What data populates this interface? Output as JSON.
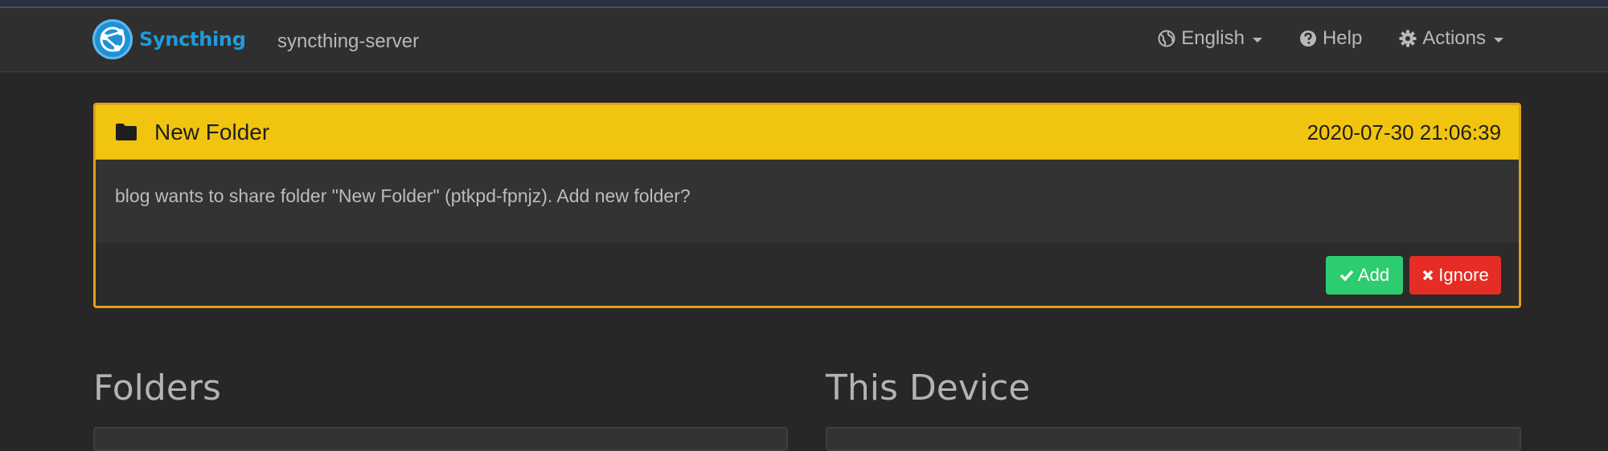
{
  "navbar": {
    "brand": "Syncthing",
    "device_name": "syncthing-server",
    "language_label": "English",
    "help_label": "Help",
    "actions_label": "Actions",
    "icons": {
      "logo": "syncthing-logo",
      "language": "globe-icon",
      "help": "question-circle-icon",
      "actions": "gear-icon"
    }
  },
  "notification": {
    "title": "New Folder",
    "timestamp": "2020-07-30 21:06:39",
    "message": "blog wants to share folder \"New Folder\" (ptkpd-fpnjz). Add new folder?",
    "add_label": "Add",
    "ignore_label": "Ignore",
    "colors": {
      "heading": "#f1c40f",
      "border": "#e1a01b",
      "add": "#2ecc71",
      "ignore": "#e52d25"
    }
  },
  "sections": {
    "folders_title": "Folders",
    "this_device_title": "This Device"
  }
}
